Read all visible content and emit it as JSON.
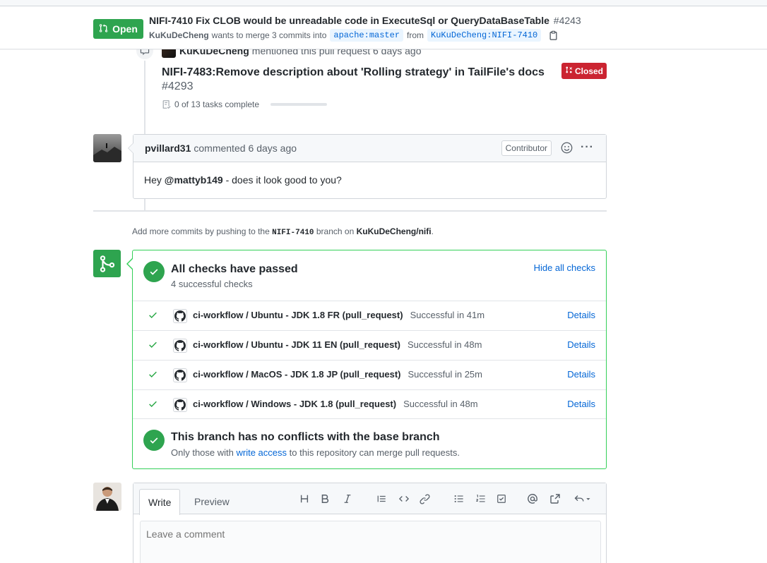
{
  "header": {
    "state": "Open",
    "title": "NIFI-7410 Fix CLOB would be unreadable code in ExecuteSql or QueryDataBaseTable",
    "number": "#4243",
    "author": "KuKuDeCheng",
    "merge_text": "wants to merge 3 commits into",
    "base_branch": "apache:master",
    "from_text": "from",
    "head_branch": "KuKuDeCheng:NIFI-7410"
  },
  "mention": {
    "author": "KuKuDeCheng",
    "text": "mentioned this pull request 6 days ago",
    "ref_title": "NIFI-7483:Remove description about 'Rolling strategy' in TailFile's docs",
    "ref_number": "#4293",
    "ref_state": "Closed",
    "tasks": "0 of 13 tasks complete"
  },
  "comment": {
    "author": "pvillard31",
    "action": "commented",
    "time": "6 days ago",
    "role": "Contributor",
    "more": "···",
    "body_prefix": "Hey",
    "body_mention": "@mattyb149",
    "body_suffix": " - does it look good to you?"
  },
  "push_hint": {
    "prefix": "Add more commits by pushing to the",
    "branch": "NIFI-7410",
    "middle": "branch on",
    "repo": "KuKuDeCheng/nifi",
    "suffix": "."
  },
  "checks": {
    "title": "All checks have passed",
    "subtitle": "4 successful checks",
    "toggle": "Hide all checks",
    "items": [
      {
        "name": "ci-workflow / Ubuntu - JDK 1.8 FR (pull_request)",
        "status": "Successful in 41m",
        "link": "Details"
      },
      {
        "name": "ci-workflow / Ubuntu - JDK 11 EN (pull_request)",
        "status": "Successful in 48m",
        "link": "Details"
      },
      {
        "name": "ci-workflow / MacOS - JDK 1.8 JP (pull_request)",
        "status": "Successful in 25m",
        "link": "Details"
      },
      {
        "name": "ci-workflow / Windows - JDK 1.8 (pull_request)",
        "status": "Successful in 48m",
        "link": "Details"
      }
    ]
  },
  "conflicts": {
    "title": "This branch has no conflicts with the base branch",
    "sub_prefix": "Only those with",
    "sub_link": "write access",
    "sub_suffix": "to this repository can merge pull requests."
  },
  "editor": {
    "tab_write": "Write",
    "tab_preview": "Preview",
    "placeholder": "Leave a comment",
    "tools": [
      "heading-icon",
      "bold-icon",
      "italic-icon",
      "quote-icon",
      "code-icon",
      "link-icon",
      "bullet-list-icon",
      "numbered-list-icon",
      "task-list-icon",
      "mention-icon",
      "cross-reference-icon",
      "reply-icon"
    ]
  },
  "colors": {
    "success": "#2ea44f",
    "closed": "#cb2431",
    "link": "#0366d6"
  }
}
